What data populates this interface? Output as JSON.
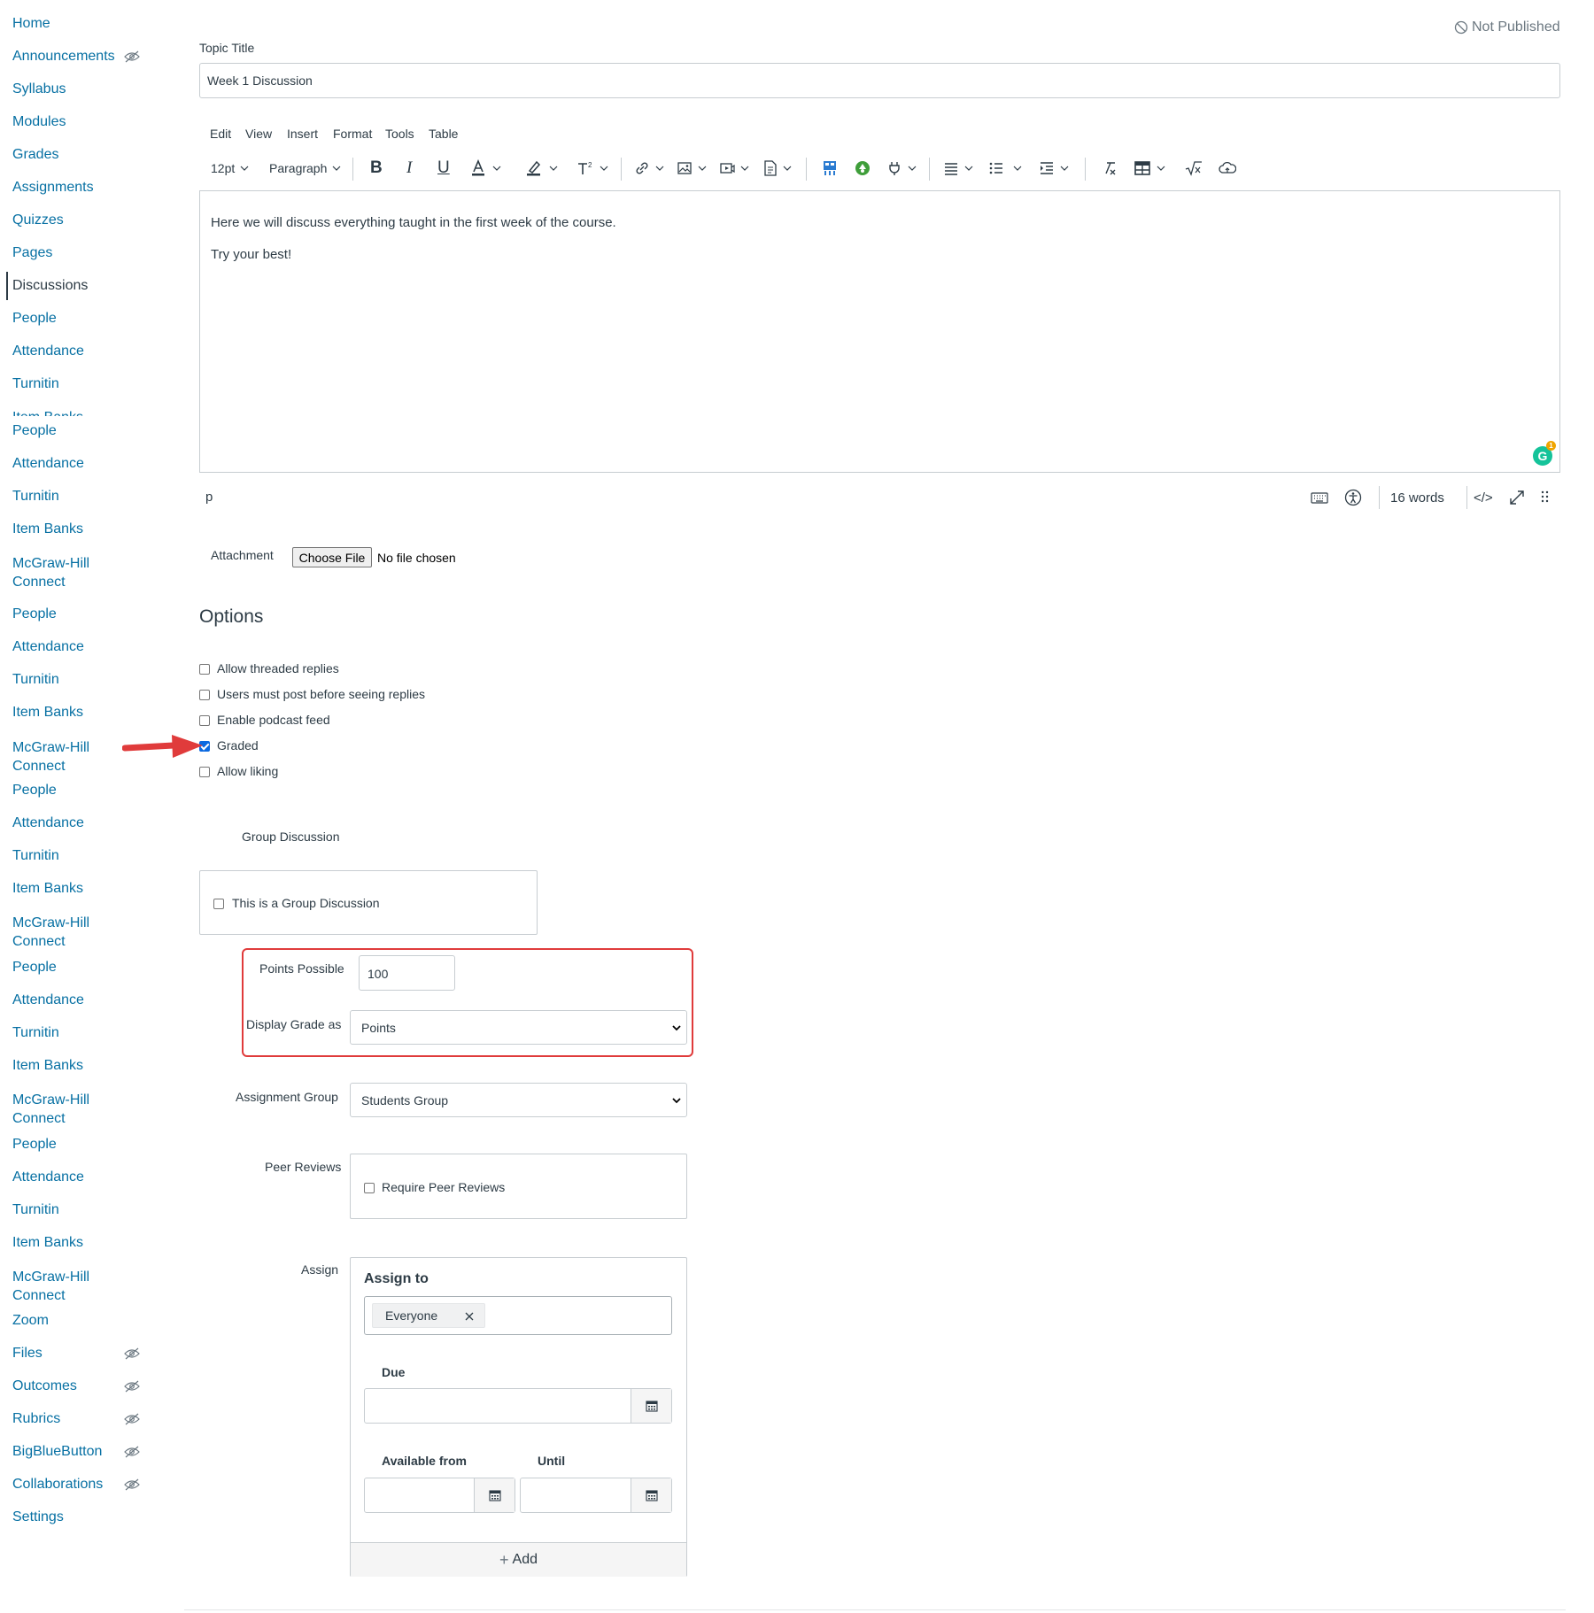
{
  "sidebar": {
    "items": [
      {
        "label": "Home"
      },
      {
        "label": "Announcements",
        "hidden_icon": "eye-slash-icon"
      },
      {
        "label": "Syllabus"
      },
      {
        "label": "Modules"
      },
      {
        "label": "Grades"
      },
      {
        "label": "Assignments"
      },
      {
        "label": "Quizzes"
      },
      {
        "label": "Pages"
      },
      {
        "label": "Discussions",
        "active": true
      },
      {
        "label": "People"
      },
      {
        "label": "Attendance"
      },
      {
        "label": "Turnitin"
      },
      {
        "label": "Item Banks"
      },
      {
        "label": "People"
      },
      {
        "label": "Attendance"
      },
      {
        "label": "Turnitin"
      },
      {
        "label": "Item Banks"
      },
      {
        "label": "McGraw-Hill Connect"
      },
      {
        "label": "People"
      },
      {
        "label": "Attendance"
      },
      {
        "label": "Turnitin"
      },
      {
        "label": "Item Banks"
      },
      {
        "label": "McGraw-Hill Connect"
      },
      {
        "label": "People"
      },
      {
        "label": "Attendance"
      },
      {
        "label": "Turnitin"
      },
      {
        "label": "Item Banks"
      },
      {
        "label": "McGraw-Hill Connect"
      },
      {
        "label": "People"
      },
      {
        "label": "Attendance"
      },
      {
        "label": "Turnitin"
      },
      {
        "label": "Item Banks"
      },
      {
        "label": "McGraw-Hill Connect"
      },
      {
        "label": "People"
      },
      {
        "label": "Attendance"
      },
      {
        "label": "Turnitin"
      },
      {
        "label": "Item Banks"
      },
      {
        "label": "McGraw-Hill Connect"
      },
      {
        "label": "Zoom"
      },
      {
        "label": "Files",
        "hidden_icon": "eye-slash-icon"
      },
      {
        "label": "Outcomes",
        "hidden_icon": "eye-slash-icon"
      },
      {
        "label": "Rubrics",
        "hidden_icon": "eye-slash-icon"
      },
      {
        "label": "BigBlueButton",
        "hidden_icon": "eye-slash-icon"
      },
      {
        "label": "Collaborations",
        "hidden_icon": "eye-slash-icon"
      },
      {
        "label": "Settings"
      }
    ]
  },
  "header": {
    "status": "Not Published"
  },
  "topic": {
    "title_label": "Topic Title",
    "title_value": "Week 1 Discussion"
  },
  "editor": {
    "menu": [
      "Edit",
      "View",
      "Insert",
      "Format",
      "Tools",
      "Table"
    ],
    "font_size": "12pt",
    "block_format": "Paragraph",
    "content": [
      "Here we will discuss everything taught in the first week of the course.",
      "Try your best!"
    ],
    "path": "p",
    "word_count": "16 words",
    "html_toggle": "</>",
    "grammarly_badge": "1"
  },
  "attachment": {
    "label": "Attachment",
    "button": "Choose File",
    "status": "No file chosen"
  },
  "options": {
    "heading": "Options",
    "checkboxes": [
      {
        "label": "Allow threaded replies",
        "checked": false
      },
      {
        "label": "Users must post before seeing replies",
        "checked": false
      },
      {
        "label": "Enable podcast feed",
        "checked": false
      },
      {
        "label": "Graded",
        "checked": true
      },
      {
        "label": "Allow liking",
        "checked": false
      }
    ]
  },
  "group": {
    "heading": "Group Discussion",
    "checkbox_label": "This is a Group Discussion"
  },
  "grading": {
    "points_label": "Points Possible",
    "points_value": "100",
    "display_label": "Display Grade as",
    "display_value": "Points",
    "assignment_group_label": "Assignment Group",
    "assignment_group_value": "Students Group",
    "peer_label": "Peer Reviews",
    "peer_checkbox": "Require Peer Reviews"
  },
  "assign": {
    "label": "Assign",
    "assign_to": "Assign to",
    "tag": "Everyone",
    "due": "Due",
    "available_from": "Available from",
    "until": "Until",
    "add": "Add"
  },
  "colors": {
    "link": "#0770a3",
    "annotation_red": "#e03b3b",
    "checkbox_blue": "#0b69e0"
  }
}
